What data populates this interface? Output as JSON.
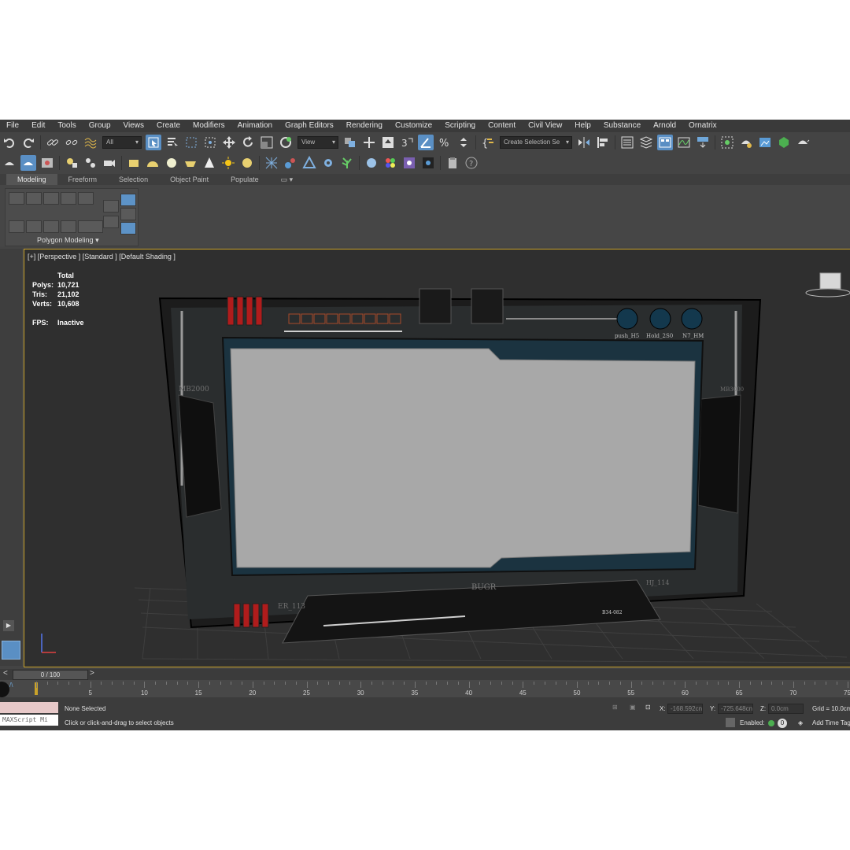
{
  "menu": [
    "File",
    "Edit",
    "Tools",
    "Group",
    "Views",
    "Create",
    "Modifiers",
    "Animation",
    "Graph Editors",
    "Rendering",
    "Customize",
    "Scripting",
    "Content",
    "Civil View",
    "Help",
    "Substance",
    "Arnold",
    "Ornatrix"
  ],
  "toolbar": {
    "filter_value": "All",
    "ref_coord_value": "View",
    "selection_set_placeholder": "Create Selection Se"
  },
  "ribbon": {
    "tabs": [
      "Modeling",
      "Freeform",
      "Selection",
      "Object Paint",
      "Populate"
    ],
    "panel_label": "Polygon Modeling"
  },
  "viewport": {
    "label": "[+] [Perspective ] [Standard ] [Default Shading ]",
    "stats": {
      "header": "Total",
      "rows": [
        {
          "key": "Polys:",
          "value": "10,721"
        },
        {
          "key": "Tris:",
          "value": "21,102"
        },
        {
          "key": "Verts:",
          "value": "10,608"
        }
      ],
      "fps_key": "FPS:",
      "fps_value": "Inactive"
    },
    "model_labels": {
      "mb_left": "MB2000",
      "mb_right": "MB3000",
      "knob1": "push_H5",
      "knob2": "Hold_2S0",
      "knob3": "N7_HM",
      "bottom": "BUGR",
      "er": "ER_113",
      "hj": "HJ_114",
      "stand": "B34-082"
    }
  },
  "timeline": {
    "frame_label": "0 / 100",
    "ticks": [
      "0",
      "5",
      "10",
      "15",
      "20",
      "25",
      "30",
      "35",
      "40",
      "45",
      "50",
      "55",
      "60",
      "65",
      "70",
      "75"
    ]
  },
  "status": {
    "none_selected": "None Selected",
    "hint": "Click or click-and-drag to select objects",
    "maxscript": "MAXScript Mi",
    "x_label": "X:",
    "x_value": "-168.592cn",
    "y_label": "Y:",
    "y_value": "-725.648cn",
    "z_label": "Z:",
    "z_value": "0.0cm",
    "grid": "Grid = 10.0cm",
    "enabled": "Enabled:",
    "enabled_value": "0",
    "add_time_tag": "Add Time Tag"
  },
  "colors": {
    "accent_blue": "#5a8fc4",
    "viewport_border": "#c9a22a",
    "screen_grey": "#a8a8a8"
  }
}
